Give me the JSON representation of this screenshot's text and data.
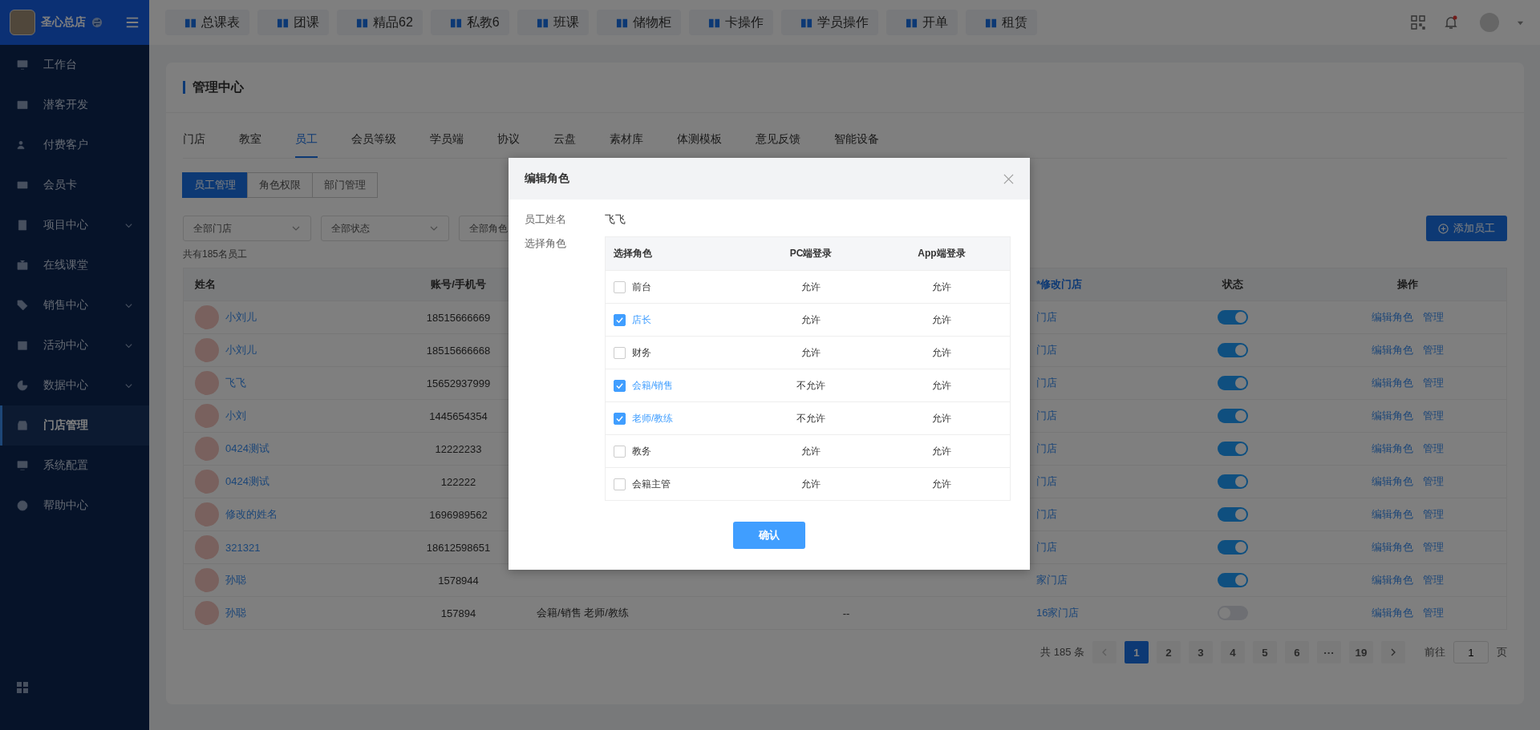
{
  "sidebar": {
    "brand": "圣心总店",
    "items": [
      {
        "label": "工作台",
        "expandable": false,
        "selected": false
      },
      {
        "label": "潜客开发",
        "expandable": false,
        "selected": false
      },
      {
        "label": "付费客户",
        "expandable": false,
        "selected": false
      },
      {
        "label": "会员卡",
        "expandable": false,
        "selected": false
      },
      {
        "label": "项目中心",
        "expandable": true,
        "selected": false
      },
      {
        "label": "在线课堂",
        "expandable": false,
        "selected": false
      },
      {
        "label": "销售中心",
        "expandable": true,
        "selected": false
      },
      {
        "label": "活动中心",
        "expandable": true,
        "selected": false
      },
      {
        "label": "数据中心",
        "expandable": true,
        "selected": false
      },
      {
        "label": "门店管理",
        "expandable": false,
        "selected": true
      },
      {
        "label": "系统配置",
        "expandable": false,
        "selected": false
      },
      {
        "label": "帮助中心",
        "expandable": false,
        "selected": false
      }
    ]
  },
  "quick_buttons": [
    "总课表",
    "团课",
    "精品62",
    "私教6",
    "班课",
    "储物柜",
    "卡操作",
    "学员操作",
    "开单",
    "租赁"
  ],
  "page_title": "管理中心",
  "tabs": [
    {
      "label": "门店",
      "selected": false
    },
    {
      "label": "教室",
      "selected": false
    },
    {
      "label": "员工",
      "selected": true
    },
    {
      "label": "会员等级",
      "selected": false
    },
    {
      "label": "学员端",
      "selected": false
    },
    {
      "label": "协议",
      "selected": false
    },
    {
      "label": "云盘",
      "selected": false
    },
    {
      "label": "素材库",
      "selected": false
    },
    {
      "label": "体测模板",
      "selected": false
    },
    {
      "label": "意见反馈",
      "selected": false
    },
    {
      "label": "智能设备",
      "selected": false
    }
  ],
  "sub_tabs": [
    {
      "label": "员工管理",
      "selected": true
    },
    {
      "label": "角色权限",
      "selected": false
    },
    {
      "label": "部门管理",
      "selected": false
    }
  ],
  "filters": [
    "全部门店",
    "全部状态",
    "全部角色"
  ],
  "add_button": "添加员工",
  "count": "共有185名员工",
  "table": {
    "columns": [
      "姓名",
      "账号/手机号",
      "",
      "",
      "*修改门店",
      "状态",
      "操作"
    ],
    "rows": [
      {
        "name": "小刘儿",
        "account": "18515666669",
        "roles": "",
        "column_4": "",
        "stores": "门店",
        "on": true
      },
      {
        "name": "小刘儿",
        "account": "18515666668",
        "roles": "",
        "column_4": "",
        "stores": "门店",
        "on": true
      },
      {
        "name": "飞飞",
        "account": "15652937999",
        "roles": "",
        "column_4": "",
        "stores": "门店",
        "on": true
      },
      {
        "name": "小刘",
        "account": "1445654354",
        "roles": "",
        "column_4": "",
        "stores": "门店",
        "on": true
      },
      {
        "name": "0424测试",
        "account": "12222233",
        "roles": "",
        "column_4": "",
        "stores": "门店",
        "on": true
      },
      {
        "name": "0424测试",
        "account": "122222",
        "roles": "",
        "column_4": "",
        "stores": "门店",
        "on": true
      },
      {
        "name": "修改的姓名",
        "account": "1696989562",
        "roles": "",
        "column_4": "",
        "stores": "门店",
        "on": true
      },
      {
        "name": "321321",
        "account": "18612598651",
        "roles": "",
        "column_4": "",
        "stores": "门店",
        "on": true
      },
      {
        "name": "孙聪",
        "account": "1578944",
        "roles": "",
        "column_4": "",
        "stores": "家门店",
        "on": true
      },
      {
        "name": "孙聪",
        "account": "157894",
        "roles": "会籍/销售 老师/教练",
        "column_4": "--",
        "stores": "16家门店",
        "on": false
      }
    ],
    "actions": [
      [
        "编辑角色",
        "管理"
      ],
      [
        "编辑角色",
        "管理"
      ],
      [
        "编辑角色",
        "管理"
      ],
      [
        "编辑角色",
        "管理"
      ],
      [
        "编辑角色",
        "管理"
      ],
      [
        "编辑角色",
        "管理"
      ],
      [
        "编辑角色",
        "管理"
      ],
      [
        "编辑角色",
        "管理"
      ],
      [
        "编辑角色",
        "管理"
      ],
      [
        "编辑角色",
        "管理"
      ]
    ]
  },
  "pagination": {
    "total": "共 185 条",
    "pages": [
      {
        "label": "1",
        "selected": true
      },
      {
        "label": "2",
        "selected": false
      },
      {
        "label": "3",
        "selected": false
      },
      {
        "label": "4",
        "selected": false
      },
      {
        "label": "5",
        "selected": false
      },
      {
        "label": "6",
        "selected": false
      },
      {
        "label": "···",
        "selected": false
      },
      {
        "label": "19",
        "selected": false
      }
    ],
    "goto_label": "前往",
    "goto_value": "1",
    "page_unit": "页"
  },
  "dialog": {
    "title": "编辑角色",
    "name_label": "员工姓名",
    "name_value": "飞飞",
    "role_label": "选择角色",
    "columns": [
      "选择角色",
      "PC端登录",
      "App端登录"
    ],
    "roles": [
      {
        "name": "前台",
        "checked": false,
        "pc": "允许",
        "app": "允许"
      },
      {
        "name": "店长",
        "checked": true,
        "pc": "允许",
        "app": "允许"
      },
      {
        "name": "财务",
        "checked": false,
        "pc": "允许",
        "app": "允许"
      },
      {
        "name": "会籍/销售",
        "checked": true,
        "pc": "不允许",
        "app": "允许"
      },
      {
        "name": "老师/教练",
        "checked": true,
        "pc": "不允许",
        "app": "允许"
      },
      {
        "name": "教务",
        "checked": false,
        "pc": "允许",
        "app": "允许"
      },
      {
        "name": "会籍主管",
        "checked": false,
        "pc": "允许",
        "app": "允许"
      }
    ],
    "confirm": "确认"
  }
}
